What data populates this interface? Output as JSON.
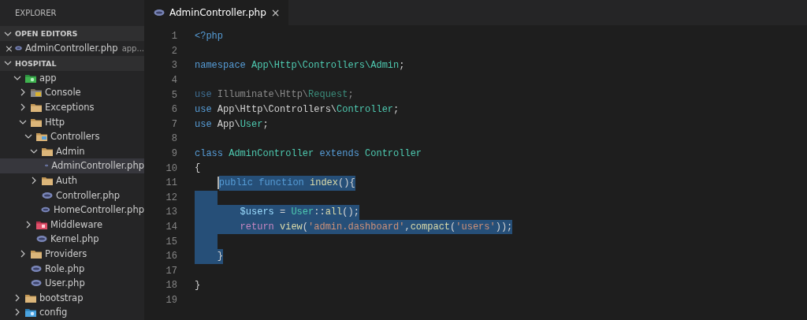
{
  "sidebar": {
    "title": "EXPLORER",
    "open_editors": {
      "label": "OPEN EDITORS",
      "expanded": true,
      "items": [
        {
          "close": "×",
          "name": "AdminController.php",
          "description": "app...",
          "kind": "php"
        }
      ]
    },
    "project": {
      "label": "HOSPITAL",
      "expanded": true,
      "tree": [
        {
          "name": "app",
          "kind": "folder-app",
          "expanded": true,
          "selected": false,
          "children": [
            {
              "name": "Console",
              "kind": "folder-console",
              "expanded": false,
              "selected": false
            },
            {
              "name": "Exceptions",
              "kind": "folder",
              "expanded": false,
              "selected": false
            },
            {
              "name": "Http",
              "kind": "folder",
              "expanded": true,
              "selected": false,
              "children": [
                {
                  "name": "Controllers",
                  "kind": "folder-controllers",
                  "expanded": true,
                  "selected": false,
                  "children": [
                    {
                      "name": "Admin",
                      "kind": "folder",
                      "expanded": true,
                      "selected": false,
                      "children": [
                        {
                          "name": "AdminController.php",
                          "kind": "php",
                          "selected": true
                        }
                      ]
                    },
                    {
                      "name": "Auth",
                      "kind": "folder",
                      "expanded": false,
                      "selected": false
                    },
                    {
                      "name": "Controller.php",
                      "kind": "php",
                      "selected": false
                    },
                    {
                      "name": "HomeController.php",
                      "kind": "php",
                      "selected": false
                    }
                  ]
                },
                {
                  "name": "Middleware",
                  "kind": "folder-middleware",
                  "expanded": false,
                  "selected": false
                },
                {
                  "name": "Kernel.php",
                  "kind": "php",
                  "selected": false
                }
              ]
            },
            {
              "name": "Providers",
              "kind": "folder",
              "expanded": false,
              "selected": false
            },
            {
              "name": "Role.php",
              "kind": "php",
              "selected": false
            },
            {
              "name": "User.php",
              "kind": "php",
              "selected": false
            }
          ]
        },
        {
          "name": "bootstrap",
          "kind": "folder",
          "expanded": false,
          "selected": false
        },
        {
          "name": "config",
          "kind": "folder-config",
          "expanded": false,
          "selected": false
        }
      ]
    }
  },
  "tabs": [
    {
      "name": "AdminController.php",
      "kind": "php",
      "close": "×",
      "selected": true
    }
  ],
  "code": [
    {
      "number": "1",
      "kind": "top",
      "cursor": false,
      "selected": false,
      "tokens": [
        {
          "text": "<?php",
          "kind": "keyword"
        }
      ]
    },
    {
      "number": "2",
      "kind": "top",
      "cursor": false,
      "selected": false
    },
    {
      "number": "3",
      "kind": "top",
      "cursor": false,
      "selected": false,
      "tokens": [
        {
          "text": "namespace ",
          "kind": "keyword"
        },
        {
          "text": "App\\Http\\Controllers\\Admin",
          "kind": "type"
        },
        {
          "text": ";",
          "kind": "plain"
        }
      ]
    },
    {
      "number": "4",
      "kind": "top",
      "cursor": false,
      "selected": false
    },
    {
      "number": "5",
      "kind": "top",
      "cursor": false,
      "selected": false,
      "tokens": [
        {
          "text": "use ",
          "kind": "faded-keyword"
        },
        {
          "text": "Illuminate\\Http\\",
          "kind": "faded"
        },
        {
          "text": "Request",
          "kind": "faded-type"
        },
        {
          "text": ";",
          "kind": "faded"
        }
      ]
    },
    {
      "number": "6",
      "kind": "top",
      "cursor": false,
      "selected": false,
      "tokens": [
        {
          "text": "use ",
          "kind": "keyword"
        },
        {
          "text": "App\\Http\\Controllers\\",
          "kind": "plain"
        },
        {
          "text": "Controller",
          "kind": "type"
        },
        {
          "text": ";",
          "kind": "plain"
        }
      ]
    },
    {
      "number": "7",
      "kind": "top",
      "cursor": false,
      "selected": false,
      "tokens": [
        {
          "text": "use ",
          "kind": "keyword"
        },
        {
          "text": "App\\",
          "kind": "plain"
        },
        {
          "text": "User",
          "kind": "type"
        },
        {
          "text": ";",
          "kind": "plain"
        }
      ]
    },
    {
      "number": "8",
      "kind": "top",
      "cursor": false,
      "selected": false
    },
    {
      "number": "9",
      "kind": "top",
      "cursor": false,
      "selected": false,
      "tokens": [
        {
          "text": "class ",
          "kind": "keyword"
        },
        {
          "text": "AdminController ",
          "kind": "type"
        },
        {
          "text": "extends ",
          "kind": "keyword"
        },
        {
          "text": "Controller",
          "kind": "type"
        }
      ]
    },
    {
      "number": "10",
      "kind": "top",
      "cursor": false,
      "selected": false,
      "tokens": [
        {
          "text": "{",
          "kind": "plain"
        }
      ]
    },
    {
      "number": "11",
      "kind": "body",
      "cursor": true,
      "selected": true,
      "tokens": [
        {
          "text": "public function ",
          "kind": "keyword"
        },
        {
          "text": "index",
          "kind": "function"
        },
        {
          "text": "(){",
          "kind": "plain"
        }
      ]
    },
    {
      "number": "12",
      "kind": "body",
      "cursor": false,
      "selected": true
    },
    {
      "number": "13",
      "kind": "nested",
      "cursor": false,
      "selected": true,
      "tokens": [
        {
          "text": "$users",
          "kind": "variable"
        },
        {
          "text": " = ",
          "kind": "plain"
        },
        {
          "text": "User",
          "kind": "type"
        },
        {
          "text": "::",
          "kind": "plain"
        },
        {
          "text": "all",
          "kind": "function"
        },
        {
          "text": "();",
          "kind": "plain"
        }
      ]
    },
    {
      "number": "14",
      "kind": "nested",
      "cursor": false,
      "selected": true,
      "tokens": [
        {
          "text": "return ",
          "kind": "control"
        },
        {
          "text": "view",
          "kind": "function"
        },
        {
          "text": "(",
          "kind": "plain"
        },
        {
          "text": "'admin.dashboard'",
          "kind": "string"
        },
        {
          "text": ",",
          "kind": "plain"
        },
        {
          "text": "compact",
          "kind": "function"
        },
        {
          "text": "(",
          "kind": "plain"
        },
        {
          "text": "'users'",
          "kind": "string"
        },
        {
          "text": "));",
          "kind": "plain"
        }
      ]
    },
    {
      "number": "15",
      "kind": "body",
      "cursor": false,
      "selected": true
    },
    {
      "number": "16",
      "kind": "body",
      "cursor": false,
      "selected": true,
      "tokens": [
        {
          "text": "}",
          "kind": "plain"
        }
      ]
    },
    {
      "number": "17",
      "kind": "top",
      "cursor": false,
      "selected": false
    },
    {
      "number": "18",
      "kind": "top",
      "cursor": false,
      "selected": false,
      "tokens": [
        {
          "text": "}",
          "kind": "plain"
        }
      ]
    },
    {
      "number": "19",
      "kind": "top",
      "cursor": false,
      "selected": false
    }
  ]
}
